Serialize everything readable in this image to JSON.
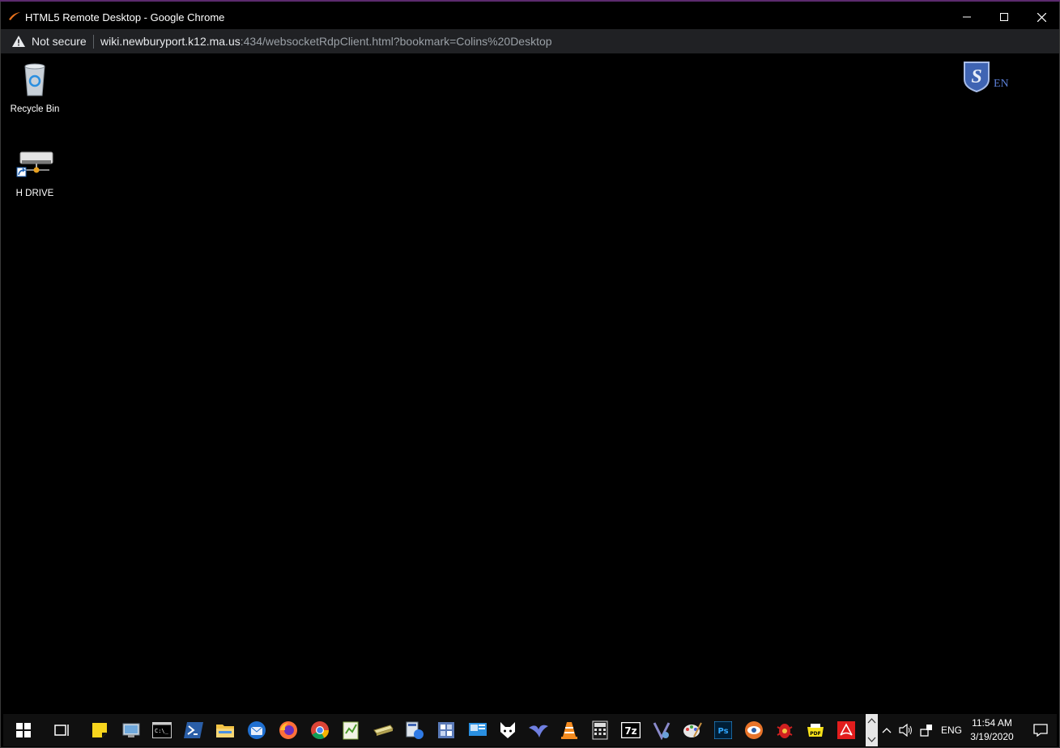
{
  "window": {
    "title": "HTML5 Remote Desktop - Google Chrome",
    "controls": [
      "minimize-icon",
      "maximize-icon",
      "close-icon"
    ]
  },
  "address_bar": {
    "security_label": "Not secure",
    "url_host": "wiki.newburyport.k12.ma.us",
    "url_rest": ":434/websocketRdpClient.html?bookmark=Colins%20Desktop"
  },
  "desktop": {
    "icons": [
      {
        "label": "Recycle Bin",
        "icon": "recycle-bin-icon"
      },
      {
        "label": "H DRIVE",
        "icon": "network-drive-icon"
      }
    ],
    "brand_badge": {
      "letter": "S",
      "lang": "EN"
    }
  },
  "taskbar": {
    "apps": [
      "start-icon",
      "task-view-icon",
      "sticky-notes-icon",
      "system-info-icon",
      "command-prompt-icon",
      "powershell-icon",
      "file-explorer-icon",
      "thunderbird-icon",
      "firefox-icon",
      "chrome-icon",
      "notepad-plus-icon",
      "scanner-icon",
      "remote-desktop-icon",
      "registry-editor-icon",
      "network-admin-icon",
      "foxit-icon",
      "kite-icon",
      "vlc-icon",
      "calculator-icon",
      "seven-zip-icon",
      "visual-studio-icon",
      "paint-icon",
      "photoshop-icon",
      "eye-app-icon",
      "bug-app-icon",
      "pdf-creator-icon",
      "acrobat-icon"
    ],
    "tray": {
      "language": "ENG",
      "time": "11:54 AM",
      "date": "3/19/2020"
    }
  },
  "colors": {
    "chrome_dark": "#202124",
    "taskbar": "#101010",
    "accent_purple": "#5b2a6e",
    "brand_blue": "#5b7fd6"
  }
}
